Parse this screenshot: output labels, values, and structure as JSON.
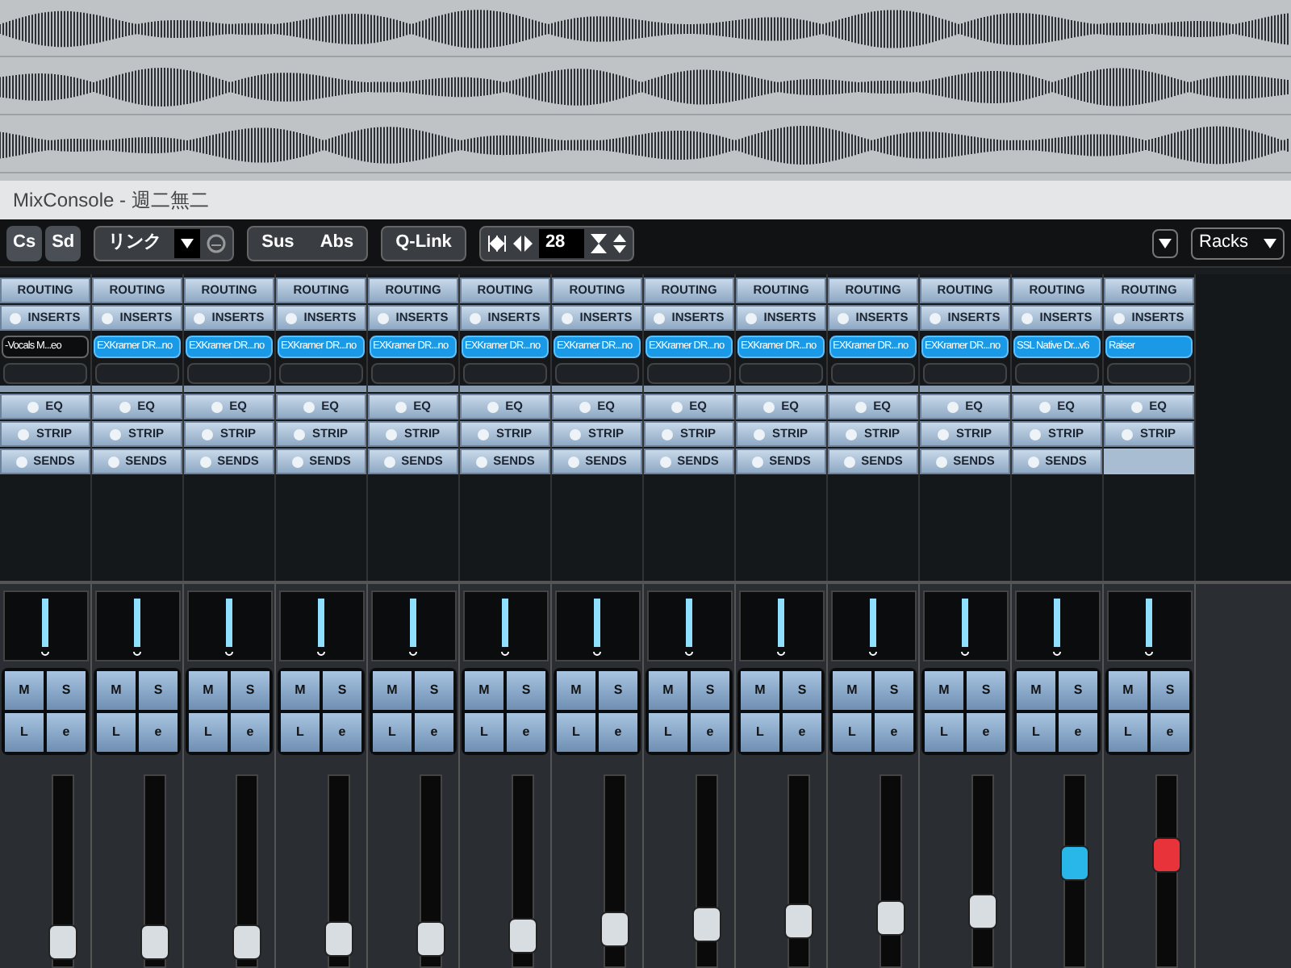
{
  "window": {
    "title": "MixConsole - 週二無二"
  },
  "toolbar": {
    "left_buttons": [
      "Cs",
      "Sd"
    ],
    "link_label": "リンク",
    "group_buttons": [
      "Sus",
      "Abs"
    ],
    "qlink": "Q-Link",
    "channel_count": "28",
    "racks": "Racks"
  },
  "channels": [
    {
      "routing": "ROUTING",
      "inserts": "INSERTS",
      "insert": "-Vocals M...eo",
      "insert_active": false,
      "eq": "EQ",
      "strip": "STRIP",
      "sends": "SENDS",
      "buttons": [
        "M",
        "S",
        "L",
        "e"
      ],
      "fader": {
        "level": 0.04,
        "color": "#d8dde2"
      }
    },
    {
      "routing": "ROUTING",
      "inserts": "INSERTS",
      "insert": "EXKramer DR...no",
      "insert_active": true,
      "eq": "EQ",
      "strip": "STRIP",
      "sends": "SENDS",
      "buttons": [
        "M",
        "S",
        "L",
        "e"
      ],
      "fader": {
        "level": 0.04,
        "color": "#d8dde2"
      }
    },
    {
      "routing": "ROUTING",
      "inserts": "INSERTS",
      "insert": "EXKramer DR...no",
      "insert_active": true,
      "eq": "EQ",
      "strip": "STRIP",
      "sends": "SENDS",
      "buttons": [
        "M",
        "S",
        "L",
        "e"
      ],
      "fader": {
        "level": 0.04,
        "color": "#d8dde2"
      }
    },
    {
      "routing": "ROUTING",
      "inserts": "INSERTS",
      "insert": "EXKramer DR...no",
      "insert_active": true,
      "eq": "EQ",
      "strip": "STRIP",
      "sends": "SENDS",
      "buttons": [
        "M",
        "S",
        "L",
        "e"
      ],
      "fader": {
        "level": 0.06,
        "color": "#d8dde2"
      }
    },
    {
      "routing": "ROUTING",
      "inserts": "INSERTS",
      "insert": "EXKramer DR...no",
      "insert_active": true,
      "eq": "EQ",
      "strip": "STRIP",
      "sends": "SENDS",
      "buttons": [
        "M",
        "S",
        "L",
        "e"
      ],
      "fader": {
        "level": 0.06,
        "color": "#d8dde2"
      }
    },
    {
      "routing": "ROUTING",
      "inserts": "INSERTS",
      "insert": "EXKramer DR...no",
      "insert_active": true,
      "eq": "EQ",
      "strip": "STRIP",
      "sends": "SENDS",
      "buttons": [
        "M",
        "S",
        "L",
        "e"
      ],
      "fader": {
        "level": 0.08,
        "color": "#d8dde2"
      }
    },
    {
      "routing": "ROUTING",
      "inserts": "INSERTS",
      "insert": "EXKramer DR...no",
      "insert_active": true,
      "eq": "EQ",
      "strip": "STRIP",
      "sends": "SENDS",
      "buttons": [
        "M",
        "S",
        "L",
        "e"
      ],
      "fader": {
        "level": 0.12,
        "color": "#d8dde2"
      }
    },
    {
      "routing": "ROUTING",
      "inserts": "INSERTS",
      "insert": "EXKramer DR...no",
      "insert_active": true,
      "eq": "EQ",
      "strip": "STRIP",
      "sends": "SENDS",
      "buttons": [
        "M",
        "S",
        "L",
        "e"
      ],
      "fader": {
        "level": 0.16,
        "color": "#d8dde2"
      }
    },
    {
      "routing": "ROUTING",
      "inserts": "INSERTS",
      "insert": "EXKramer DR...no",
      "insert_active": true,
      "eq": "EQ",
      "strip": "STRIP",
      "sends": "SENDS",
      "buttons": [
        "M",
        "S",
        "L",
        "e"
      ],
      "fader": {
        "level": 0.18,
        "color": "#d8dde2"
      }
    },
    {
      "routing": "ROUTING",
      "inserts": "INSERTS",
      "insert": "EXKramer DR...no",
      "insert_active": true,
      "eq": "EQ",
      "strip": "STRIP",
      "sends": "SENDS",
      "buttons": [
        "M",
        "S",
        "L",
        "e"
      ],
      "fader": {
        "level": 0.2,
        "color": "#d8dde2"
      }
    },
    {
      "routing": "ROUTING",
      "inserts": "INSERTS",
      "insert": "EXKramer DR...no",
      "insert_active": true,
      "eq": "EQ",
      "strip": "STRIP",
      "sends": "SENDS",
      "buttons": [
        "M",
        "S",
        "L",
        "e"
      ],
      "fader": {
        "level": 0.24,
        "color": "#d8dde2"
      }
    },
    {
      "routing": "ROUTING",
      "inserts": "INSERTS",
      "insert": "SSL Native Dr...v6",
      "insert_active": true,
      "eq": "EQ",
      "strip": "STRIP",
      "sends": "SENDS",
      "buttons": [
        "M",
        "S",
        "L",
        "e"
      ],
      "fader": {
        "level": 0.55,
        "color": "#29b6e8"
      }
    },
    {
      "routing": "ROUTING",
      "inserts": "INSERTS",
      "insert": "Raiser",
      "insert_active": true,
      "eq": "EQ",
      "strip": "STRIP",
      "buttons": [
        "M",
        "S",
        "L",
        "e"
      ],
      "fader": {
        "level": 0.6,
        "color": "#e8333b"
      }
    }
  ]
}
